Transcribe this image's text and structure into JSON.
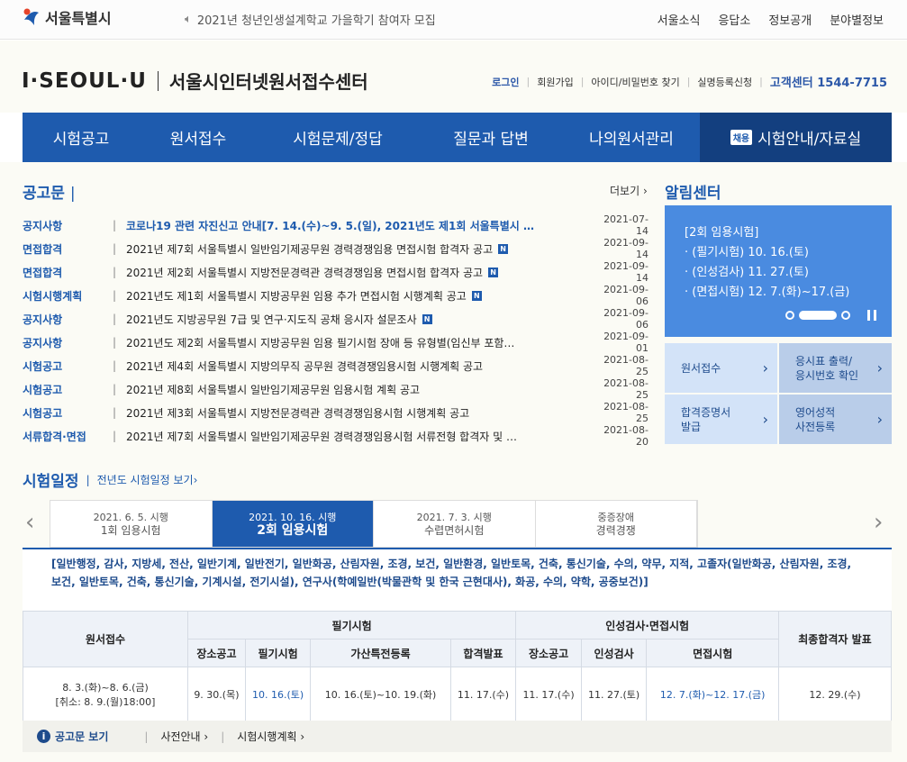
{
  "top": {
    "logo_text": "서울특별시",
    "notice": "2021년 청년인생설계학교 가을학기 참여자 모집",
    "links": [
      "서울소식",
      "응답소",
      "정보공개",
      "분야별정보"
    ]
  },
  "header": {
    "brand": "I·SEOUL·U",
    "title": "서울시인터넷원서접수센터",
    "links": [
      "로그인",
      "회원가입",
      "아이디/비밀번호 찾기",
      "실명등록신청"
    ],
    "cs_label": "고객센터 1544-7715"
  },
  "gnb": [
    "시험공고",
    "원서접수",
    "시험문제/정답",
    "질문과 답변",
    "나의원서관리",
    "시험안내/자료실"
  ],
  "gnb_badge": "채용",
  "notices_section": {
    "title": "공고문",
    "more": "더보기",
    "items": [
      {
        "cat": "공지사항",
        "text": "코로나19 관련 자진신고 안내[7. 14.(수)~9. 5.(일), 2021년도 제1회 서울특별시 …",
        "date": "2021-07-14",
        "bold": true,
        "new": false
      },
      {
        "cat": "면접합격",
        "text": "2021년 제7회 서울특별시 일반임기제공무원 경력경쟁임용 면접시험 합격자 공고",
        "date": "2021-09-14",
        "bold": false,
        "new": true
      },
      {
        "cat": "면접합격",
        "text": "2021년 제2회 서울특별시 지방전문경력관 경력경쟁임용 면접시험 합격자 공고",
        "date": "2021-09-14",
        "bold": false,
        "new": true
      },
      {
        "cat": "시험시행계획",
        "text": "2021년도 제1회 서울특별시 지방공무원 임용 추가 면접시험 시행계획 공고",
        "date": "2021-09-06",
        "bold": false,
        "new": true
      },
      {
        "cat": "공지사항",
        "text": "2021년도 지방공무원 7급 및 연구·지도직 공채 응시자 설문조사",
        "date": "2021-09-06",
        "bold": false,
        "new": true
      },
      {
        "cat": "공지사항",
        "text": "2021년도 제2회 서울특별시 지방공무원 임용 필기시험 장애 등 유형별(임신부 포함…",
        "date": "2021-09-01",
        "bold": false,
        "new": false
      },
      {
        "cat": "시험공고",
        "text": "2021년 제4회 서울특별시 지방의무직 공무원 경력경쟁임용시험 시행계획 공고",
        "date": "2021-08-25",
        "bold": false,
        "new": false
      },
      {
        "cat": "시험공고",
        "text": "2021년 제8회 서울특별시 일반임기제공무원 임용시험 계획 공고",
        "date": "2021-08-25",
        "bold": false,
        "new": false
      },
      {
        "cat": "시험공고",
        "text": "2021년 제3회 서울특별시 지방전문경력관 경력경쟁임용시험 시행계획 공고",
        "date": "2021-08-25",
        "bold": false,
        "new": false
      },
      {
        "cat": "서류합격·면접",
        "text": "2021년 제7회 서울특별시 일반임기제공무원 경력경쟁임용시험 서류전형 합격자 및 …",
        "date": "2021-08-20",
        "bold": false,
        "new": false
      }
    ]
  },
  "alim": {
    "title": "알림센터",
    "lines": [
      "[2회 임용시험]",
      "· (필기시험) 10. 16.(토)",
      "· (인성검사) 11. 27.(토)",
      "· (면접시험) 12. 7.(화)~17.(금)"
    ]
  },
  "quick": [
    {
      "label1": "원서접수",
      "label2": ""
    },
    {
      "label1": "응시표 출력/",
      "label2": "응시번호 확인"
    },
    {
      "label1": "합격증명서",
      "label2": "발급"
    },
    {
      "label1": "영어성적",
      "label2": "사전등록"
    }
  ],
  "schedule": {
    "title": "시험일정",
    "prev_link": "전년도 시험일정 보기",
    "tabs": [
      {
        "l1": "2021. 6. 5. 시행",
        "l2": "1회 임용시험"
      },
      {
        "l1": "2021. 10. 16. 시행",
        "l2": "2회 임용시험"
      },
      {
        "l1": "2021. 7. 3. 시행",
        "l2": "수렵면허시험"
      },
      {
        "l1": "중증장애",
        "l2": "경력경쟁"
      }
    ],
    "fields": "[일반행정, 감사, 지방세, 전산, 일반기계, 일반전기, 일반화공, 산림자원, 조경, 보건, 일반환경, 일반토목, 건축, 통신기술, 수의, 약무, 지적, 고졸자(일반화공, 산림자원, 조경, 보건, 일반토목, 건축, 통신기술, 기계시설, 전기시설), 연구사(학예일반(박물관학 및 한국 근현대사), 화공, 수의, 약학, 공중보건)]",
    "head1": {
      "apply": "원서접수",
      "written": "필기시험",
      "interview": "인성검사·면접시험",
      "final": "최종합격자 발표"
    },
    "head2": [
      "장소공고",
      "필기시험",
      "가산특전등록",
      "합격발표",
      "장소공고",
      "인성검사",
      "면접시험"
    ],
    "apply_l1": "8. 3.(화)~8. 6.(금)",
    "apply_l2": "[취소: 8. 9.(월)18:00]",
    "row": [
      "9. 30.(목)",
      "10. 16.(토)",
      "10. 16.(토)~10. 19.(화)",
      "11. 17.(수)",
      "11. 17.(수)",
      "11. 27.(토)",
      "12. 7.(화)~12. 17.(금)",
      "12. 29.(수)"
    ]
  },
  "footer_links": {
    "info": "공고문 보기",
    "pre": "사전안내",
    "plan": "시험시행계획"
  },
  "colors": {
    "primary": "#1e5bae",
    "dark": "#133f7f",
    "alim": "#4a8be0",
    "accent": "#e5442b"
  }
}
